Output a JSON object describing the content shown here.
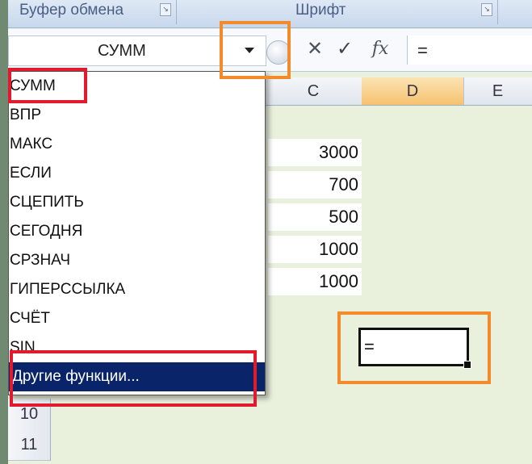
{
  "ribbon": {
    "groups": [
      "Буфер обмена",
      "Шрифт"
    ]
  },
  "formula_bar": {
    "name_box": "СУММ",
    "cancel_symbol": "✕",
    "enter_symbol": "✓",
    "fx_symbol": "fx",
    "formula_value": "="
  },
  "columns": [
    "C",
    "D",
    "E"
  ],
  "rows": [
    "10",
    "11"
  ],
  "cells_c": [
    "3000",
    "700",
    "500",
    "1000",
    "1000"
  ],
  "active_cell": {
    "value": "="
  },
  "function_list": {
    "items": [
      "СУММ",
      "ВПР",
      "МАКС",
      "ЕСЛИ",
      "СЦЕПИТЬ",
      "СЕГОДНЯ",
      "СРЗНАЧ",
      "ГИПЕРССЫЛКА",
      "СЧЁТ",
      "SIN"
    ],
    "more": "Другие функции..."
  },
  "colors": {
    "annotation_red": "#e11b2d",
    "annotation_orange": "#f38b2b",
    "selection": "#0a246a",
    "active_column": "#f6c26f"
  }
}
